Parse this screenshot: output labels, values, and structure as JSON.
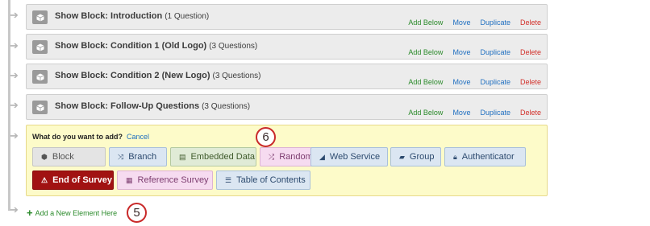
{
  "blocks": [
    {
      "prefix": "Show Block: Introduction",
      "count": "(1 Question)"
    },
    {
      "prefix": "Show Block: Condition 1 (Old Logo)",
      "count": "(3 Questions)"
    },
    {
      "prefix": "Show Block: Condition 2 (New Logo)",
      "count": "(3 Questions)"
    },
    {
      "prefix": "Show Block: Follow-Up Questions",
      "count": "(3 Questions)"
    }
  ],
  "actions": {
    "add_below": "Add Below",
    "move": "Move",
    "duplicate": "Duplicate",
    "delete": "Delete"
  },
  "add_panel": {
    "question": "What do you want to add?",
    "cancel": "Cancel",
    "elements": [
      {
        "label": "Block",
        "icon": "cube-icon"
      },
      {
        "label": "Branch",
        "icon": "branch-icon"
      },
      {
        "label": "Embedded Data",
        "icon": "embedded-data-icon"
      },
      {
        "label": "Randomizer",
        "icon": "shuffle-icon"
      },
      {
        "label": "Web Service",
        "icon": "signal-icon"
      },
      {
        "label": "Group",
        "icon": "folder-icon"
      },
      {
        "label": "Authenticator",
        "icon": "lock-icon"
      },
      {
        "label": "End of Survey",
        "icon": "warning-icon"
      },
      {
        "label": "Reference Survey",
        "icon": "document-icon"
      },
      {
        "label": "Table of Contents",
        "icon": "toc-icon"
      }
    ]
  },
  "add_new_element": "Add a New Element Here",
  "callouts": {
    "randomizer": "6",
    "add_new": "5"
  },
  "colors": {
    "add": "#2b8a2b",
    "link": "#1f6fc0",
    "delete": "#d2312b",
    "panel_bg": "#fdfbc9",
    "end_of_survey": "#a11212",
    "callout": "#c92a2a"
  }
}
